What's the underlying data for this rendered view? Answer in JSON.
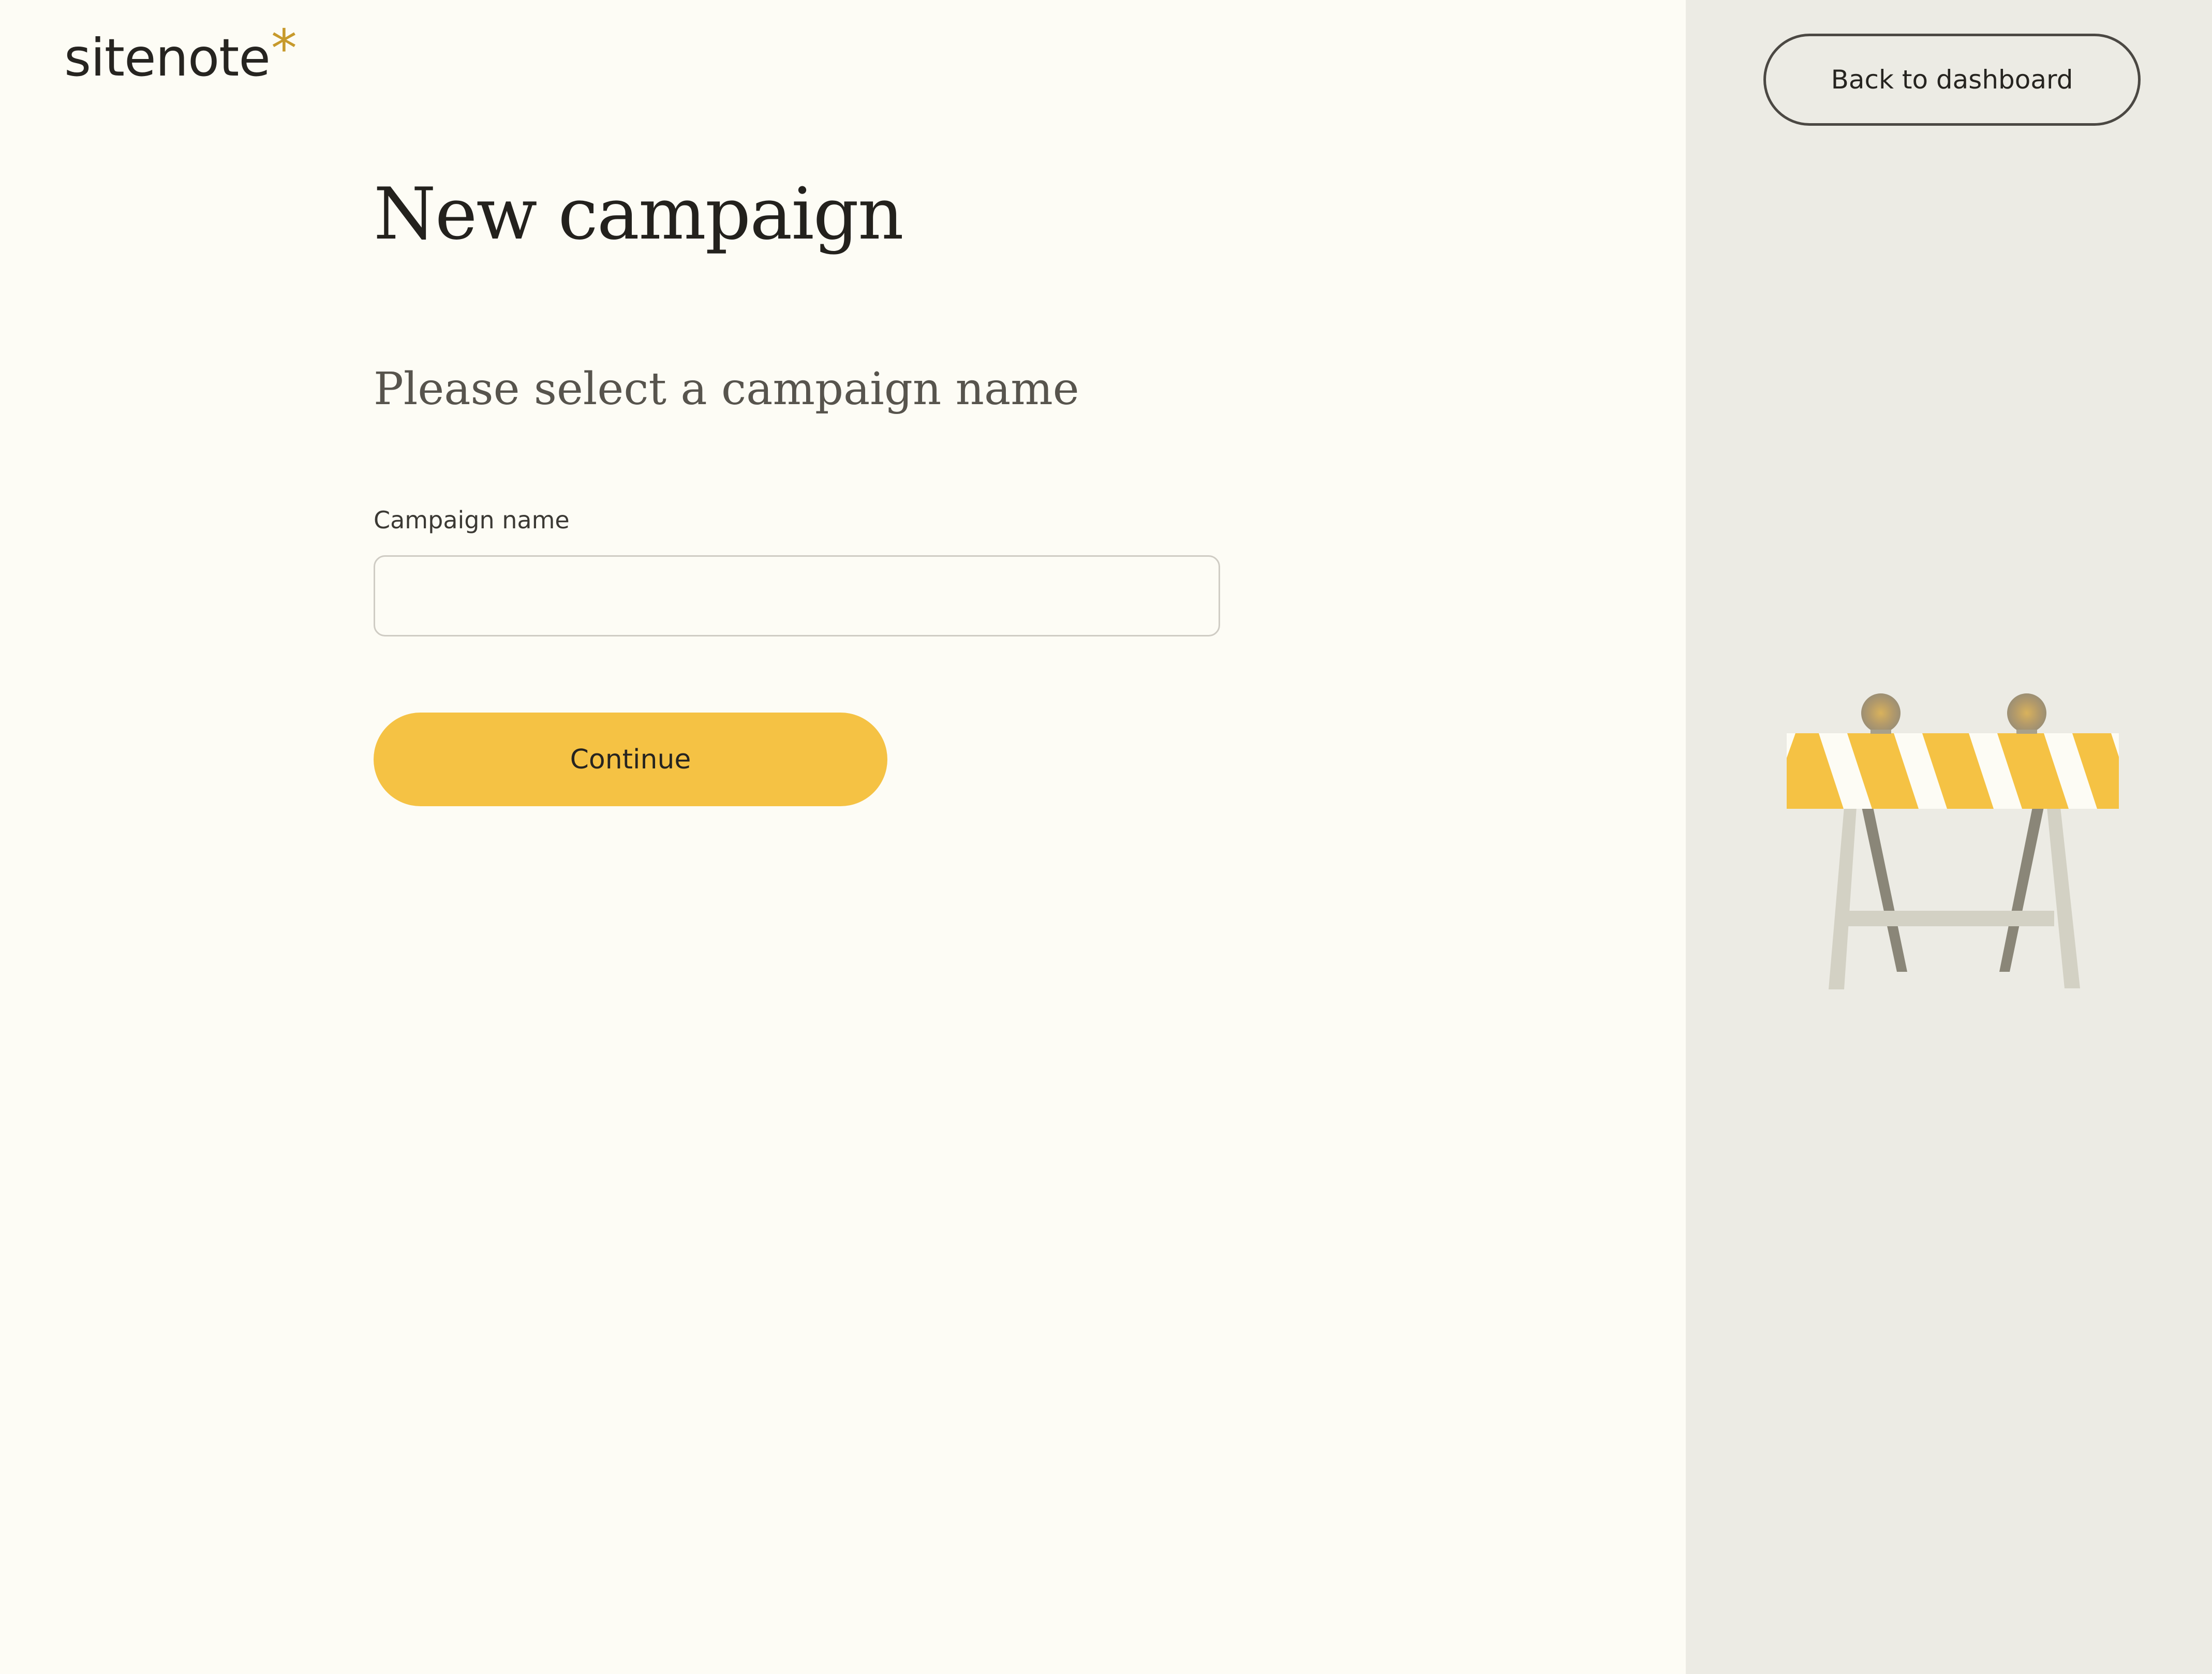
{
  "brand": {
    "name": "sitenote",
    "mark": "*"
  },
  "header": {
    "back_label": "Back to dashboard"
  },
  "page": {
    "title": "New campaign",
    "subtitle": "Please select a campaign name"
  },
  "form": {
    "campaign_name_label": "Campaign name",
    "campaign_name_value": "",
    "campaign_name_placeholder": "",
    "continue_label": "Continue"
  },
  "colors": {
    "background": "#fdfcf5",
    "side_panel": "#ecebe4",
    "accent": "#f5c244",
    "logo_mark": "#c79a2c",
    "text": "#262420"
  },
  "illustration": {
    "icon": "construction-barrier-icon"
  }
}
